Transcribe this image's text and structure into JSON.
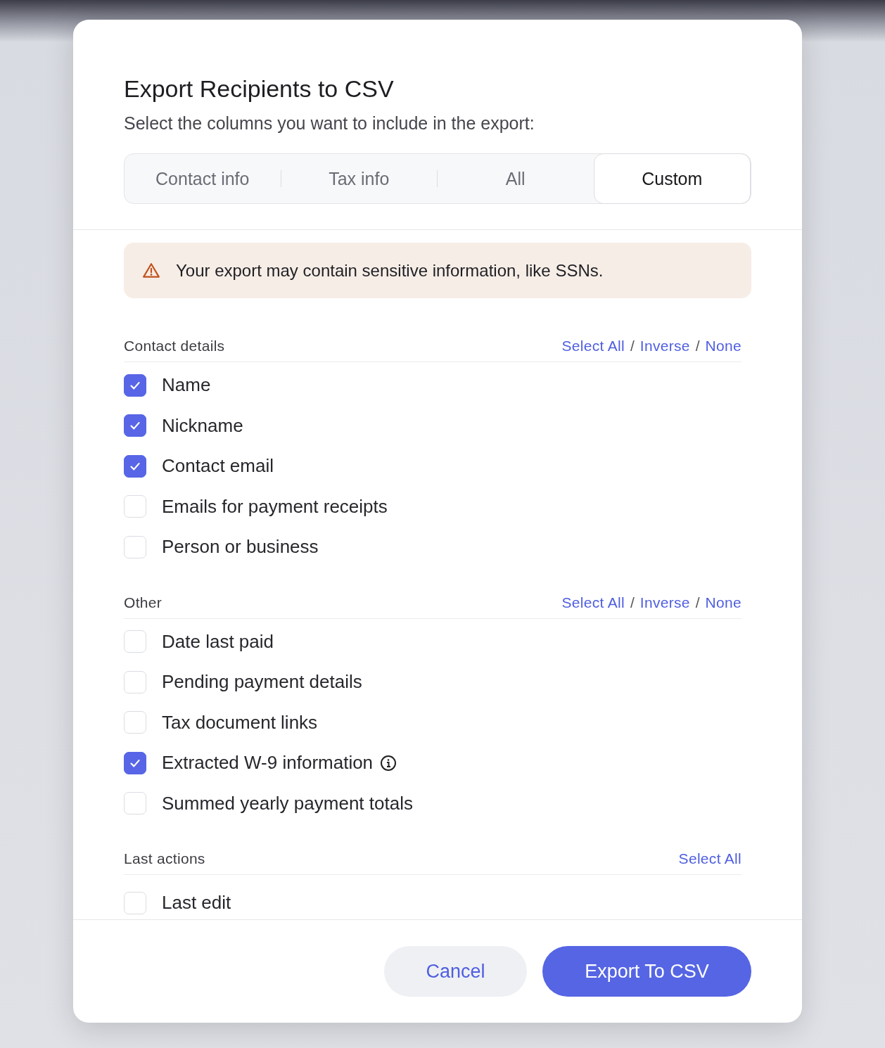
{
  "dialog": {
    "title": "Export Recipients to CSV",
    "subtitle": "Select the columns you want to include in the export:"
  },
  "tabs": [
    {
      "label": "Contact info",
      "selected": false
    },
    {
      "label": "Tax info",
      "selected": false
    },
    {
      "label": "All",
      "selected": false
    },
    {
      "label": "Custom",
      "selected": true
    }
  ],
  "warning": "Your export may contain sensitive information, like SSNs.",
  "sections": [
    {
      "title": "Contact details",
      "separator": "/",
      "links": [
        "Select All",
        "Inverse",
        "None"
      ],
      "items": [
        {
          "label": "Name",
          "checked": true,
          "info": false
        },
        {
          "label": "Nickname",
          "checked": true,
          "info": false
        },
        {
          "label": "Contact email",
          "checked": true,
          "info": false
        },
        {
          "label": "Emails for payment receipts",
          "checked": false,
          "info": false
        },
        {
          "label": "Person or business",
          "checked": false,
          "info": false
        }
      ]
    },
    {
      "title": "Other",
      "separator": "/",
      "links": [
        "Select All",
        "Inverse",
        "None"
      ],
      "items": [
        {
          "label": "Date last paid",
          "checked": false,
          "info": false
        },
        {
          "label": "Pending payment details",
          "checked": false,
          "info": false
        },
        {
          "label": "Tax document links",
          "checked": false,
          "info": false
        },
        {
          "label": "Extracted W-9 information",
          "checked": true,
          "info": true
        },
        {
          "label": "Summed yearly payment totals",
          "checked": false,
          "info": false
        }
      ]
    },
    {
      "title": "Last actions",
      "links": [
        "Select All"
      ],
      "items": [
        {
          "label": "Last edit",
          "checked": false,
          "info": false
        }
      ]
    }
  ],
  "buttons": [
    {
      "label": "Cancel",
      "kind": "secondary"
    },
    {
      "label": "Export To CSV",
      "kind": "primary"
    }
  ]
}
